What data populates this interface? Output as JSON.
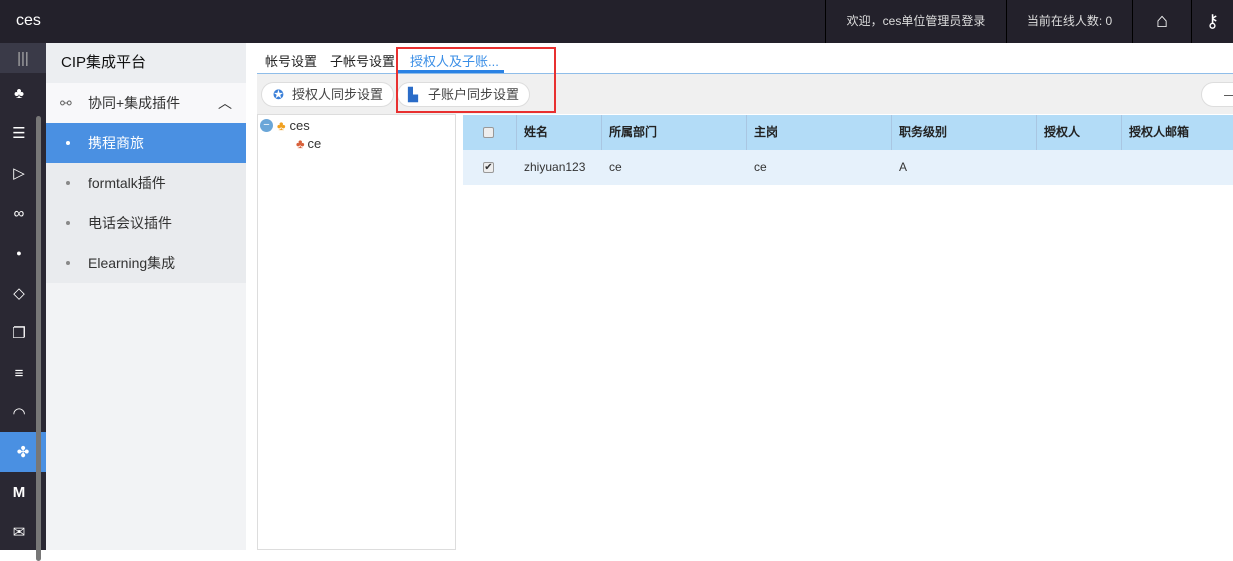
{
  "topbar": {
    "brand": "ces",
    "welcome": "欢迎，ces单位管理员登录",
    "online": "当前在线人数: 0"
  },
  "rail": {
    "icons": [
      "menu-icon",
      "org-chart-icon",
      "sliders-icon",
      "send-icon",
      "flow-icon",
      "cap-icon",
      "cube-icon",
      "documents-icon",
      "database-icon",
      "gauge-icon",
      "apps-icon",
      "m-icon",
      "wechat-icon"
    ]
  },
  "sidebar": {
    "title": "CIP集成平台",
    "group": "协同+集成插件",
    "items": [
      {
        "label": "携程商旅"
      },
      {
        "label": "formtalk插件"
      },
      {
        "label": "电话会议插件"
      },
      {
        "label": "Elearning集成"
      }
    ]
  },
  "tabs": [
    {
      "label": "帐号设置"
    },
    {
      "label": "子帐号设置"
    },
    {
      "label": "授权人及子账..."
    }
  ],
  "toolbar": {
    "btn1": "授权人同步设置",
    "btn2": "子账户同步设置",
    "right": "—"
  },
  "tree": {
    "root": "ces",
    "child": "ce"
  },
  "table": {
    "headers": [
      "姓名",
      "所属部门",
      "主岗",
      "职务级别",
      "授权人",
      "授权人邮箱"
    ],
    "rows": [
      {
        "checked": true,
        "cells": [
          "zhiyuan123",
          "ce",
          "ce",
          "A",
          "",
          ""
        ]
      }
    ]
  },
  "colors": {
    "accent": "#4a90e2",
    "topbar": "#23212b",
    "header": "#b3dcf7",
    "highlight": "#e83030"
  }
}
